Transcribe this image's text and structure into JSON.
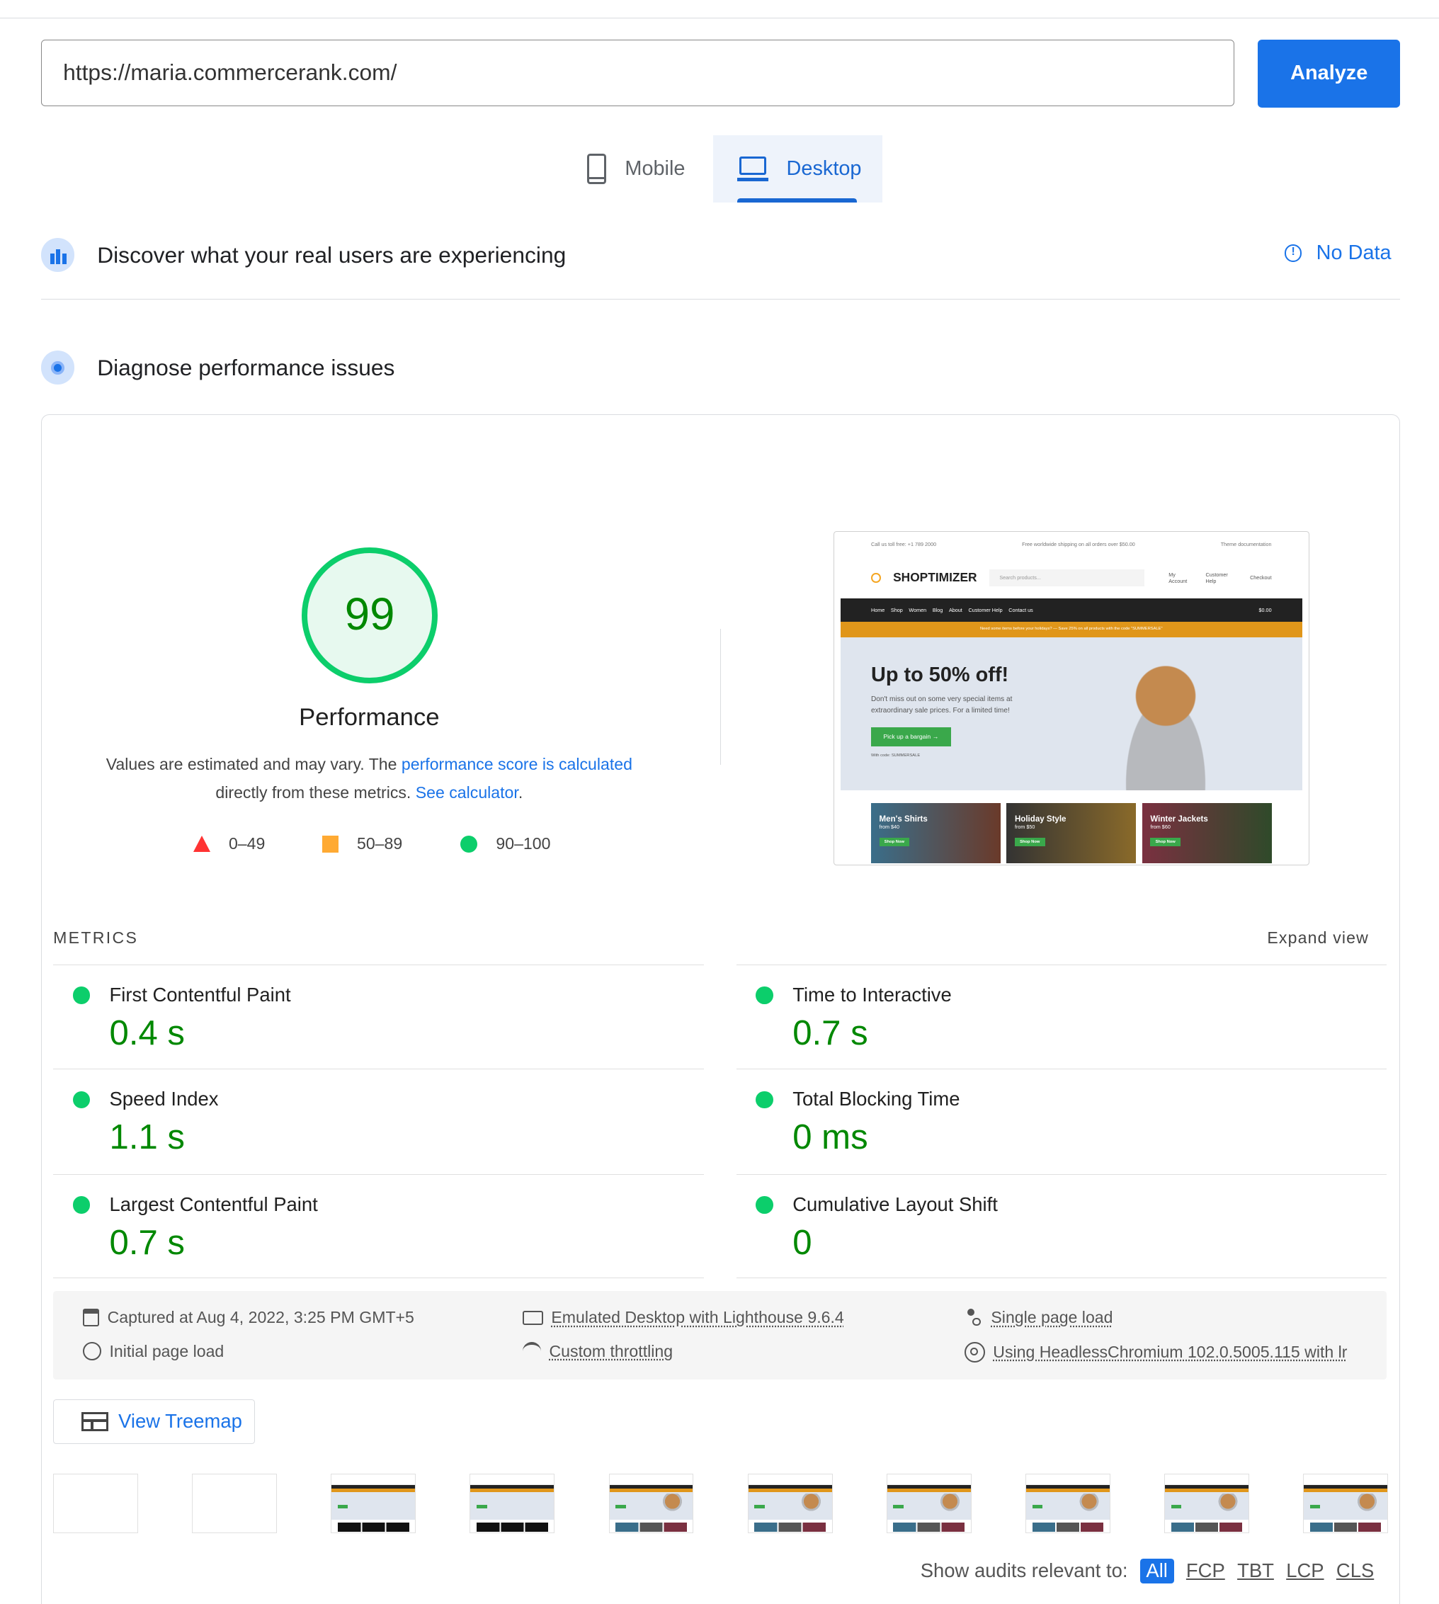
{
  "url_input": {
    "value": "https://maria.commercerank.com/"
  },
  "analyze_label": "Analyze",
  "tabs": [
    {
      "label": "Mobile",
      "icon": "smartphone-icon"
    },
    {
      "label": "Desktop",
      "icon": "laptop-icon",
      "selected": true
    }
  ],
  "field_section": {
    "title": "Discover what your real users are experiencing",
    "status": "No Data"
  },
  "lab_section": {
    "title": "Diagnose performance issues"
  },
  "score": {
    "value": "99",
    "label": "Performance",
    "color": "#0cce6b",
    "text_color": "#008800"
  },
  "description": {
    "text1": "Values are estimated and may vary. The ",
    "link1": "performance score is calculated",
    "text2": "directly from these metrics. ",
    "link2": "See calculator",
    "text3": "."
  },
  "legend": [
    {
      "range": "0–49",
      "color": "#ff3333"
    },
    {
      "range": "50–89",
      "color": "#ffaa33"
    },
    {
      "range": "90–100",
      "color": "#0cce6b"
    }
  ],
  "site_preview": {
    "topbar": [
      "Call us toll free: +1 789 2000",
      "Free worldwide shipping on all orders over $50.00",
      "Theme documentation"
    ],
    "logo": "SHOPTIMIZER",
    "search": "Search products...",
    "header_links": [
      "My Account",
      "Customer Help",
      "Checkout"
    ],
    "nav": [
      "Home",
      "Shop",
      "Women",
      "Blog",
      "About",
      "Customer Help",
      "Contact us"
    ],
    "cart": "$0.00",
    "promo": "Need some items before your holidays? — Save 25% on all products with the code \"SUMMERSALE\"",
    "hero_title": "Up to 50% off!",
    "hero_text": "Don't miss out on some very special items at extraordinary sale prices. For a limited time!",
    "hero_button": "Pick up a bargain →",
    "hero_code": "With code: SUMMERSALE",
    "tiles": [
      {
        "title": "Men's Shirts",
        "price": "from $40",
        "button": "Shop Now"
      },
      {
        "title": "Holiday Style",
        "price": "from $50",
        "button": "Shop Now"
      },
      {
        "title": "Winter Jackets",
        "price": "from $60",
        "button": "Shop Now"
      }
    ]
  },
  "metrics": {
    "heading": "METRICS",
    "expand": "Expand view",
    "left": [
      {
        "label": "First Contentful Paint",
        "value": "0.4 s"
      },
      {
        "label": "Speed Index",
        "value": "1.1 s"
      },
      {
        "label": "Largest Contentful Paint",
        "value": "0.7 s"
      }
    ],
    "right": [
      {
        "label": "Time to Interactive",
        "value": "0.7 s"
      },
      {
        "label": "Total Blocking Time",
        "value": "0 ms"
      },
      {
        "label": "Cumulative Layout Shift",
        "value": "0"
      }
    ]
  },
  "environment": {
    "captured": "Captured at Aug 4, 2022, 3:25 PM GMT+5",
    "emulated": "Emulated Desktop with Lighthouse 9.6.4",
    "single": "Single page load",
    "initial": "Initial page load",
    "throttling": "Custom throttling",
    "browser": "Using HeadlessChromium 102.0.5005.115 with lr"
  },
  "treemap_label": "View Treemap",
  "filmstrip_frames": [
    "blank",
    "blank",
    "partial",
    "partial",
    "full",
    "full",
    "full",
    "full",
    "full",
    "full"
  ],
  "audit_filter": {
    "label": "Show audits relevant to:",
    "options": [
      "All",
      "FCP",
      "TBT",
      "LCP",
      "CLS"
    ],
    "selected": "All"
  }
}
